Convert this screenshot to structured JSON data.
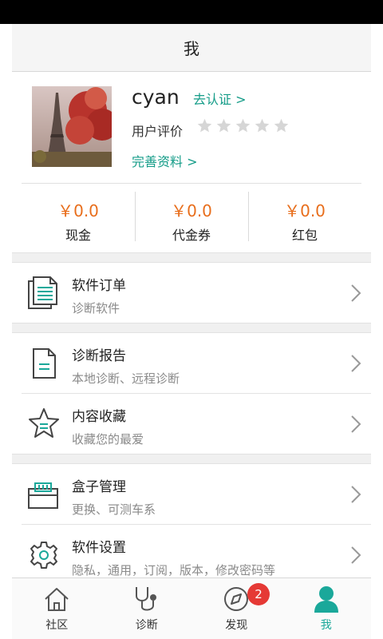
{
  "header": {
    "title": "我"
  },
  "profile": {
    "username": "cyan",
    "verify_link": "去认证 >",
    "rating_label": "用户评价",
    "rating_stars_filled": 0,
    "rating_stars_total": 5,
    "complete_link": "完善资料 >"
  },
  "wallet": [
    {
      "amount": "￥0.0",
      "label": "现金"
    },
    {
      "amount": "￥0.0",
      "label": "代金券"
    },
    {
      "amount": "￥0.0",
      "label": "红包"
    }
  ],
  "menu": {
    "software_orders": {
      "title": "软件订单",
      "subtitle": "诊断软件",
      "icon": "document-stack-icon"
    },
    "diagnostic_reports": {
      "title": "诊断报告",
      "subtitle": "本地诊断、远程诊断",
      "icon": "report-icon"
    },
    "favorites": {
      "title": "内容收藏",
      "subtitle": "收藏您的最爱",
      "icon": "star-outline-icon"
    },
    "box_management": {
      "title": "盒子管理",
      "subtitle": "更换、可测车系",
      "icon": "box-icon"
    },
    "software_settings": {
      "title": "软件设置",
      "subtitle": "隐私，通用，订阅，版本，修改密码等",
      "icon": "gear-icon"
    }
  },
  "tabs": [
    {
      "label": "社区",
      "icon": "home-icon",
      "active": false
    },
    {
      "label": "诊断",
      "icon": "stethoscope-icon",
      "active": false
    },
    {
      "label": "发现",
      "icon": "compass-icon",
      "active": false,
      "badge": "2"
    },
    {
      "label": "我",
      "icon": "person-icon",
      "active": true
    }
  ],
  "colors": {
    "accent_green": "#149c88",
    "tab_active": "#1aa89a",
    "amount_orange": "#e86e1c",
    "badge_red": "#e53935"
  }
}
